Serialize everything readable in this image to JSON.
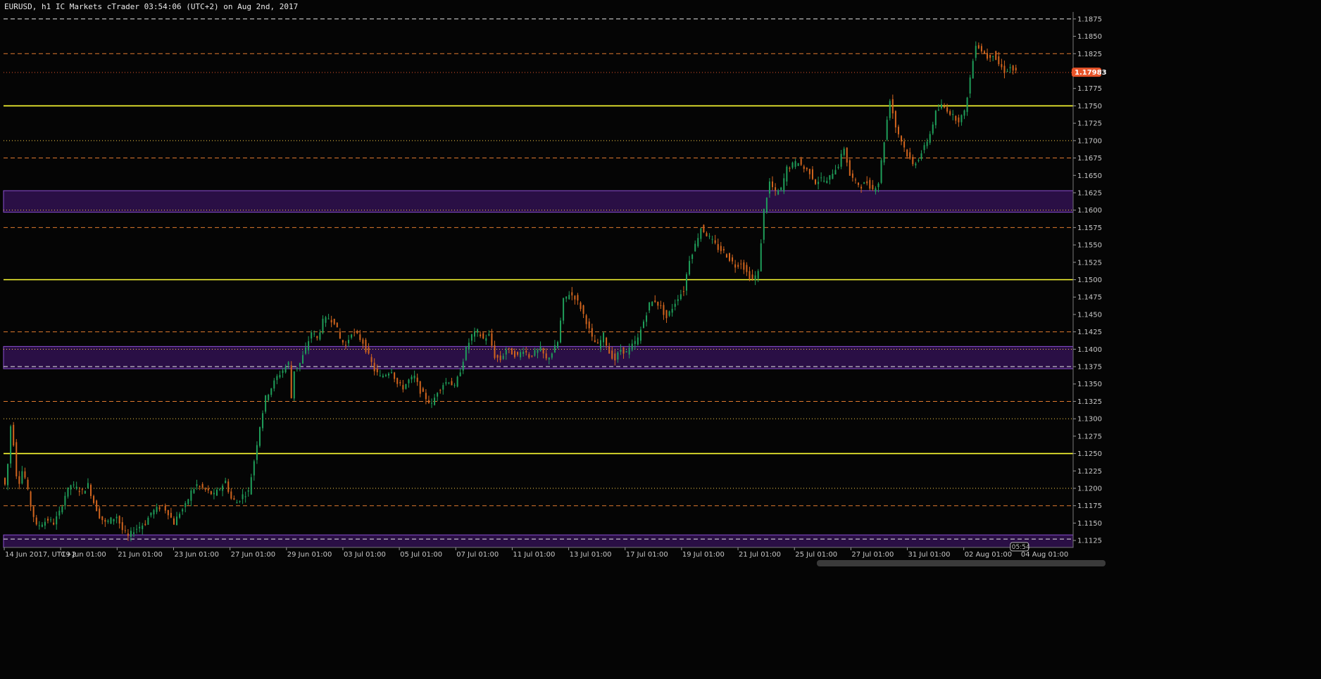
{
  "header": {
    "title": "EURUSD, h1 IC Markets cTrader 03:54:06 (UTC+2) on Aug 2nd, 2017"
  },
  "price_marker": {
    "label": "1.17983",
    "color": "#e8542a"
  },
  "time_marker": {
    "label": "05:54"
  },
  "colors": {
    "background": "#050505",
    "bull": "#1f9e5a",
    "bear": "#d2651e",
    "yellow_level": "#ffff33",
    "orange_level": "#e07a2e",
    "zone_fill": "#2a0f45",
    "zone_border": "#8a4fd0"
  },
  "chart_data": {
    "type": "candlestick",
    "symbol": "EURUSD",
    "timeframe": "h1",
    "ylim": [
      1.1115,
      1.1885
    ],
    "y_ticks": [
      "1.1125",
      "1.1150",
      "1.1175",
      "1.1200",
      "1.1225",
      "1.1250",
      "1.1275",
      "1.1300",
      "1.1325",
      "1.1350",
      "1.1375",
      "1.1400",
      "1.1425",
      "1.1450",
      "1.1475",
      "1.1500",
      "1.1525",
      "1.1550",
      "1.1575",
      "1.1600",
      "1.1625",
      "1.1650",
      "1.1675",
      "1.1700",
      "1.1725",
      "1.1750",
      "1.1775",
      "1.1800",
      "1.1825",
      "1.1850",
      "1.1875"
    ],
    "x_ticks": [
      "14 Jun 2017, UTC+2",
      "19 Jun 01:00",
      "21 Jun 01:00",
      "23 Jun 01:00",
      "27 Jun 01:00",
      "29 Jun 01:00",
      "03 Jul 01:00",
      "05 Jul 01:00",
      "07 Jul 01:00",
      "11 Jul 01:00",
      "13 Jul 01:00",
      "17 Jul 01:00",
      "19 Jul 01:00",
      "21 Jul 01:00",
      "25 Jul 01:00",
      "27 Jul 01:00",
      "31 Jul 01:00",
      "02 Aug 01:00",
      "04 Aug 01:00"
    ],
    "price_path": [
      [
        0,
        1.1215
      ],
      [
        1,
        1.1205
      ],
      [
        2,
        1.1235
      ],
      [
        3,
        1.129
      ],
      [
        4,
        1.1265
      ],
      [
        5,
        1.122
      ],
      [
        6,
        1.121
      ],
      [
        7,
        1.1225
      ],
      [
        8,
        1.1215
      ],
      [
        10,
        1.1175
      ],
      [
        12,
        1.1145
      ],
      [
        14,
        1.115
      ],
      [
        16,
        1.1155
      ],
      [
        18,
        1.115
      ],
      [
        20,
        1.1165
      ],
      [
        22,
        1.119
      ],
      [
        24,
        1.1205
      ],
      [
        26,
        1.12
      ],
      [
        28,
        1.1195
      ],
      [
        30,
        1.1205
      ],
      [
        32,
        1.118
      ],
      [
        34,
        1.116
      ],
      [
        36,
        1.115
      ],
      [
        38,
        1.1155
      ],
      [
        40,
        1.116
      ],
      [
        42,
        1.114
      ],
      [
        44,
        1.113
      ],
      [
        46,
        1.114
      ],
      [
        48,
        1.1145
      ],
      [
        50,
        1.115
      ],
      [
        52,
        1.1165
      ],
      [
        54,
        1.117
      ],
      [
        56,
        1.1175
      ],
      [
        58,
        1.1165
      ],
      [
        60,
        1.115
      ],
      [
        62,
        1.1165
      ],
      [
        64,
        1.1175
      ],
      [
        66,
        1.1195
      ],
      [
        68,
        1.1205
      ],
      [
        70,
        1.12
      ],
      [
        72,
        1.1195
      ],
      [
        74,
        1.119
      ],
      [
        76,
        1.12
      ],
      [
        78,
        1.121
      ],
      [
        80,
        1.1185
      ],
      [
        82,
        1.118
      ],
      [
        84,
        1.119
      ],
      [
        86,
        1.1195
      ],
      [
        88,
        1.124
      ],
      [
        90,
        1.129
      ],
      [
        92,
        1.133
      ],
      [
        94,
        1.1345
      ],
      [
        96,
        1.136
      ],
      [
        98,
        1.137
      ],
      [
        100,
        1.138
      ],
      [
        101,
        1.133
      ],
      [
        102,
        1.137
      ],
      [
        104,
        1.138
      ],
      [
        106,
        1.14
      ],
      [
        108,
        1.1425
      ],
      [
        110,
        1.1415
      ],
      [
        112,
        1.144
      ],
      [
        114,
        1.1445
      ],
      [
        116,
        1.144
      ],
      [
        118,
        1.1415
      ],
      [
        120,
        1.1405
      ],
      [
        122,
        1.1425
      ],
      [
        124,
        1.142
      ],
      [
        126,
        1.141
      ],
      [
        128,
        1.139
      ],
      [
        130,
        1.137
      ],
      [
        132,
        1.136
      ],
      [
        134,
        1.1365
      ],
      [
        136,
        1.137
      ],
      [
        138,
        1.135
      ],
      [
        140,
        1.1345
      ],
      [
        142,
        1.1355
      ],
      [
        144,
        1.136
      ],
      [
        146,
        1.134
      ],
      [
        148,
        1.133
      ],
      [
        150,
        1.132
      ],
      [
        152,
        1.134
      ],
      [
        154,
        1.135
      ],
      [
        156,
        1.1355
      ],
      [
        158,
        1.1345
      ],
      [
        160,
        1.137
      ],
      [
        162,
        1.14
      ],
      [
        164,
        1.142
      ],
      [
        166,
        1.1425
      ],
      [
        168,
        1.1415
      ],
      [
        170,
        1.142
      ],
      [
        172,
        1.139
      ],
      [
        174,
        1.1385
      ],
      [
        176,
        1.14
      ],
      [
        178,
        1.1395
      ],
      [
        180,
        1.139
      ],
      [
        182,
        1.14
      ],
      [
        184,
        1.139
      ],
      [
        186,
        1.1395
      ],
      [
        188,
        1.14
      ],
      [
        190,
        1.1385
      ],
      [
        192,
        1.1395
      ],
      [
        194,
        1.141
      ],
      [
        196,
        1.147
      ],
      [
        198,
        1.148
      ],
      [
        200,
        1.1475
      ],
      [
        202,
        1.146
      ],
      [
        204,
        1.144
      ],
      [
        206,
        1.1415
      ],
      [
        208,
        1.1405
      ],
      [
        210,
        1.142
      ],
      [
        212,
        1.1395
      ],
      [
        214,
        1.1385
      ],
      [
        216,
        1.14
      ],
      [
        218,
        1.1395
      ],
      [
        220,
        1.1405
      ],
      [
        222,
        1.1415
      ],
      [
        224,
        1.144
      ],
      [
        226,
        1.1465
      ],
      [
        228,
        1.147
      ],
      [
        230,
        1.146
      ],
      [
        232,
        1.1445
      ],
      [
        234,
        1.146
      ],
      [
        236,
        1.1475
      ],
      [
        238,
        1.1485
      ],
      [
        240,
        1.153
      ],
      [
        242,
        1.155
      ],
      [
        244,
        1.1575
      ],
      [
        246,
        1.1565
      ],
      [
        248,
        1.1555
      ],
      [
        250,
        1.1545
      ],
      [
        252,
        1.154
      ],
      [
        254,
        1.153
      ],
      [
        256,
        1.152
      ],
      [
        258,
        1.1525
      ],
      [
        260,
        1.151
      ],
      [
        262,
        1.15
      ],
      [
        264,
        1.151
      ],
      [
        266,
        1.16
      ],
      [
        268,
        1.164
      ],
      [
        270,
        1.1625
      ],
      [
        272,
        1.163
      ],
      [
        274,
        1.166
      ],
      [
        276,
        1.1665
      ],
      [
        278,
        1.167
      ],
      [
        280,
        1.166
      ],
      [
        282,
        1.1655
      ],
      [
        284,
        1.164
      ],
      [
        286,
        1.1645
      ],
      [
        288,
        1.164
      ],
      [
        290,
        1.1655
      ],
      [
        292,
        1.1665
      ],
      [
        294,
        1.169
      ],
      [
        296,
        1.165
      ],
      [
        298,
        1.164
      ],
      [
        300,
        1.1635
      ],
      [
        302,
        1.164
      ],
      [
        304,
        1.163
      ],
      [
        306,
        1.164
      ],
      [
        308,
        1.17
      ],
      [
        310,
        1.176
      ],
      [
        312,
        1.172
      ],
      [
        314,
        1.17
      ],
      [
        316,
        1.168
      ],
      [
        318,
        1.1665
      ],
      [
        320,
        1.1675
      ],
      [
        322,
        1.169
      ],
      [
        324,
        1.171
      ],
      [
        326,
        1.174
      ],
      [
        328,
        1.175
      ],
      [
        330,
        1.1745
      ],
      [
        332,
        1.1735
      ],
      [
        334,
        1.173
      ],
      [
        336,
        1.174
      ],
      [
        338,
        1.179
      ],
      [
        340,
        1.184
      ],
      [
        342,
        1.183
      ],
      [
        344,
        1.182
      ],
      [
        346,
        1.1825
      ],
      [
        348,
        1.181
      ],
      [
        350,
        1.18
      ],
      [
        352,
        1.1805
      ],
      [
        354,
        1.1798
      ]
    ],
    "total_bars_visible": 372,
    "horizontal_levels": [
      {
        "price": 1.1875,
        "style": "dashed",
        "color": "#e6e6e6"
      },
      {
        "price": 1.1825,
        "style": "dashed",
        "color": "#e07a2e"
      },
      {
        "price": 1.1798,
        "style": "dotted",
        "color": "#e8542a"
      },
      {
        "price": 1.175,
        "style": "solid",
        "color": "#ffff33"
      },
      {
        "price": 1.17,
        "style": "dotted",
        "color": "#ffd24a"
      },
      {
        "price": 1.1675,
        "style": "dashed",
        "color": "#e07a2e"
      },
      {
        "price": 1.16,
        "style": "dotted",
        "color": "#ffd24a"
      },
      {
        "price": 1.1575,
        "style": "dashed",
        "color": "#e07a2e"
      },
      {
        "price": 1.15,
        "style": "solid",
        "color": "#ffff33"
      },
      {
        "price": 1.1425,
        "style": "dashed",
        "color": "#e07a2e"
      },
      {
        "price": 1.14,
        "style": "dotted",
        "color": "#ffd24a"
      },
      {
        "price": 1.1375,
        "style": "dashed",
        "color": "#e6e6e6"
      },
      {
        "price": 1.1325,
        "style": "dashed",
        "color": "#e07a2e"
      },
      {
        "price": 1.13,
        "style": "dotted",
        "color": "#ffd24a"
      },
      {
        "price": 1.125,
        "style": "solid",
        "color": "#ffff33"
      },
      {
        "price": 1.12,
        "style": "dotted",
        "color": "#ffd24a"
      },
      {
        "price": 1.1175,
        "style": "dashed",
        "color": "#e07a2e"
      },
      {
        "price": 1.1127,
        "style": "dashed",
        "color": "#e6e6e6"
      }
    ],
    "zones": [
      {
        "top": 1.1628,
        "bottom": 1.1597
      },
      {
        "top": 1.1404,
        "bottom": 1.1372
      },
      {
        "top": 1.1133,
        "bottom": 1.1115
      }
    ]
  }
}
